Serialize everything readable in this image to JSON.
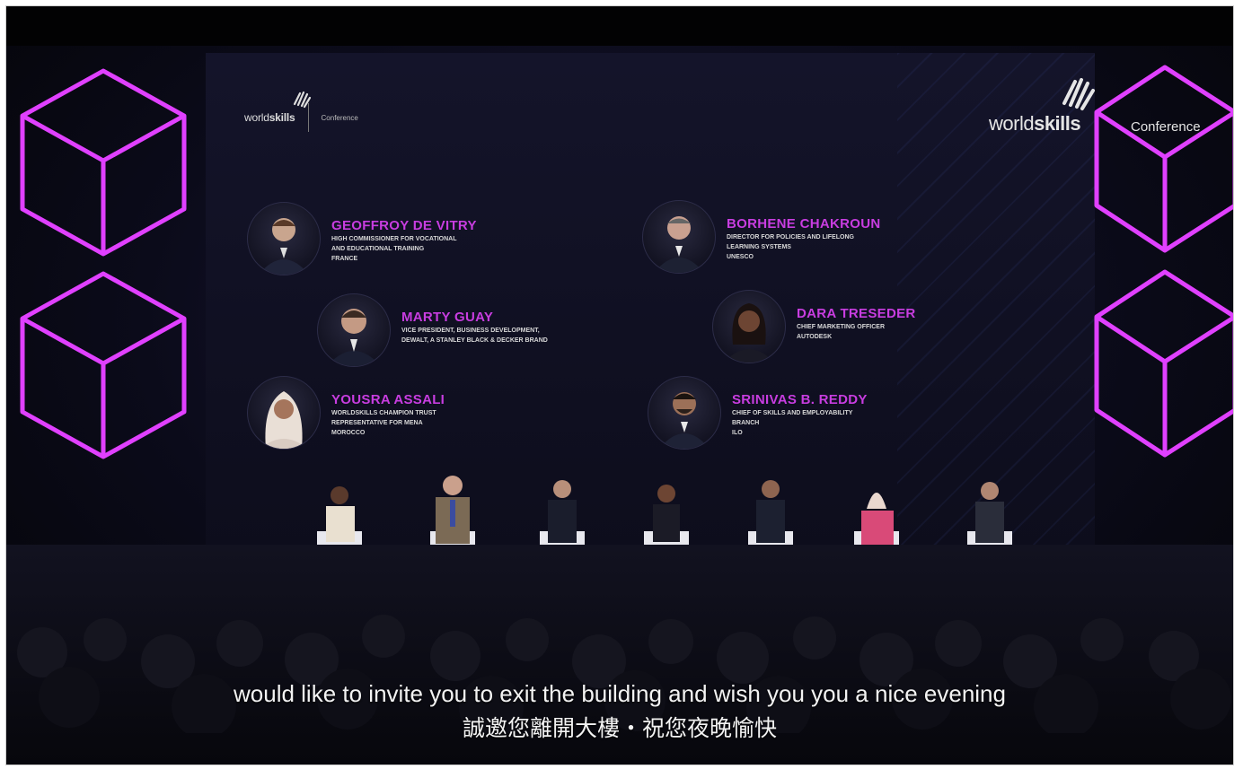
{
  "branding": {
    "logo_word_light": "world",
    "logo_word_bold": "skills",
    "logo_subtitle_small": "Conference",
    "logo_subtitle_large": "Conference"
  },
  "speakers": [
    {
      "name": "GEOFFROY DE VITRY",
      "role": [
        "HIGH COMMISSIONER FOR VOCATIONAL",
        "AND EDUCATIONAL TRAINING",
        "FRANCE"
      ]
    },
    {
      "name": "MARTY GUAY",
      "role": [
        "VICE PRESIDENT, BUSINESS DEVELOPMENT,",
        "DEWALT, A STANLEY BLACK & DECKER BRAND"
      ]
    },
    {
      "name": "YOUSRA ASSALI",
      "role": [
        "WORLDSKILLS CHAMPION TRUST",
        "REPRESENTATIVE FOR MENA",
        "MOROCCO"
      ]
    },
    {
      "name": "BORHENE CHAKROUN",
      "role": [
        "DIRECTOR FOR POLICIES AND LIFELONG",
        "LEARNING SYSTEMS",
        "UNESCO"
      ]
    },
    {
      "name": "DARA TRESEDER",
      "role": [
        "CHIEF MARKETING OFFICER",
        "AUTODESK"
      ]
    },
    {
      "name": "SRINIVAS B. REDDY",
      "role": [
        "CHIEF OF SKILLS AND EMPLOYABILITY",
        "BRANCH",
        "ILO"
      ]
    }
  ],
  "subtitles": {
    "english": "would like to invite you to exit the building and wish you you a nice evening",
    "chinese": "誠邀您離開大樓・祝您夜晚愉快"
  },
  "colors": {
    "accent_magenta": "#c83de0",
    "cube_glow": "#e040ff",
    "background": "#05050a"
  },
  "icons": {
    "logo_hand": "hand-logo-icon",
    "cube": "hexagon-cube-icon"
  }
}
